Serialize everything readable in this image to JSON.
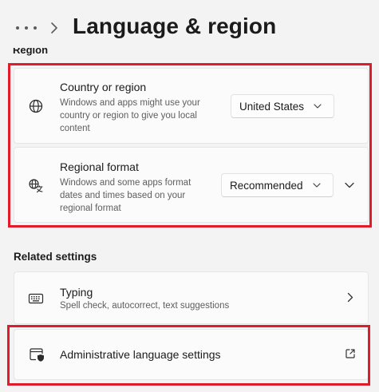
{
  "header": {
    "more_label": "...",
    "title": "Language & region"
  },
  "region_section": {
    "label": "Region",
    "country": {
      "title": "Country or region",
      "description_lines": [
        "Windows and apps might use your",
        "country or region to give you local",
        "content"
      ],
      "selected": "United States",
      "icon": "globe-icon"
    },
    "format": {
      "title": "Regional format",
      "description_lines": [
        "Windows and some apps format",
        "dates and times based on your",
        "regional format"
      ],
      "selected": "Recommended",
      "icon": "language-format-icon"
    }
  },
  "related_section": {
    "label": "Related settings",
    "typing": {
      "title": "Typing",
      "description": "Spell check, autocorrect, text suggestions",
      "icon": "keyboard-icon"
    },
    "admin": {
      "title": "Administrative language settings",
      "icon": "admin-shield-window-icon",
      "action_icon": "open-external-icon"
    }
  },
  "highlight_color": "#e01b2a"
}
